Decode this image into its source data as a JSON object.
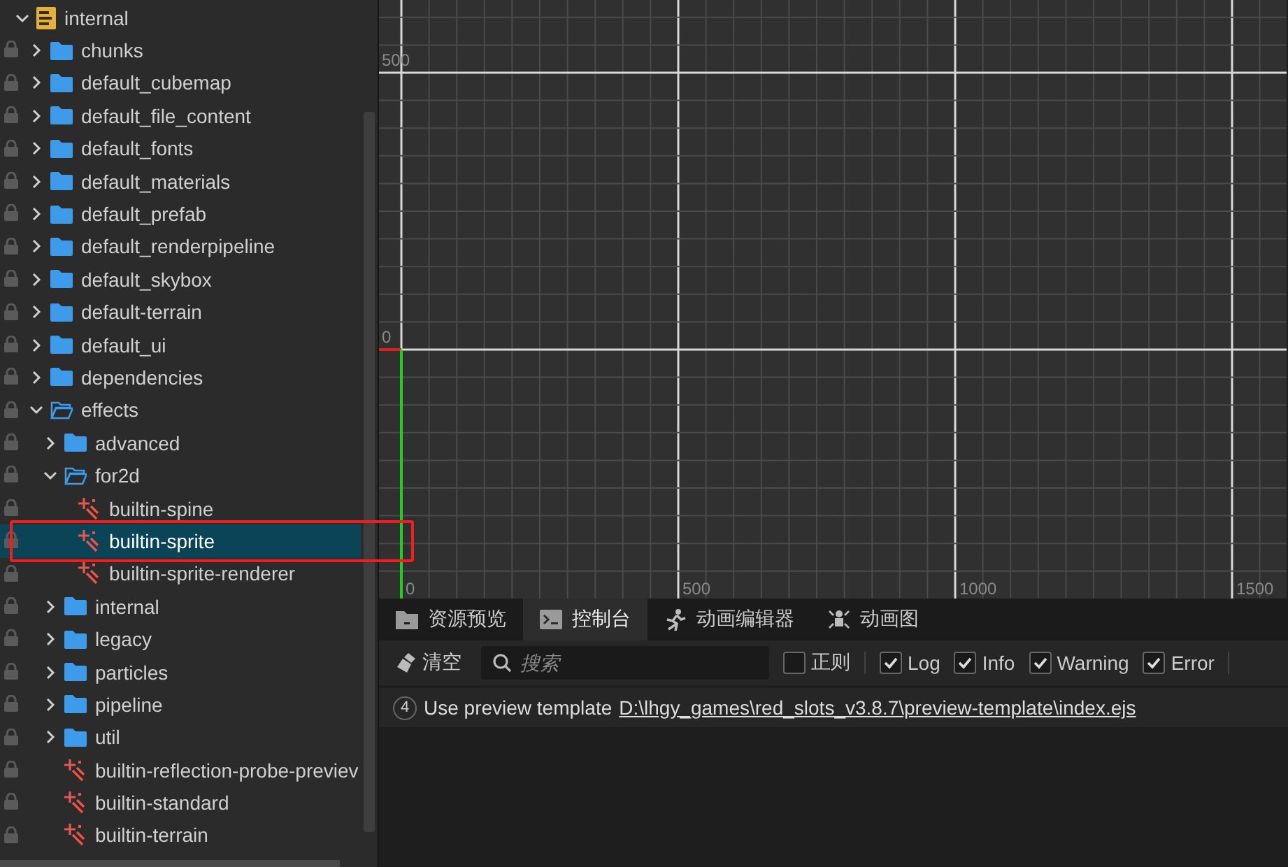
{
  "tree": [
    {
      "label": "internal",
      "kind": "bundle",
      "locked": false,
      "expanded": true,
      "selected": false,
      "children": [
        {
          "label": "chunks",
          "kind": "folder",
          "locked": true,
          "expanded": false,
          "selected": false
        },
        {
          "label": "default_cubemap",
          "kind": "folder",
          "locked": true,
          "expanded": false,
          "selected": false
        },
        {
          "label": "default_file_content",
          "kind": "folder",
          "locked": true,
          "expanded": false,
          "selected": false
        },
        {
          "label": "default_fonts",
          "kind": "folder",
          "locked": true,
          "expanded": false,
          "selected": false
        },
        {
          "label": "default_materials",
          "kind": "folder",
          "locked": true,
          "expanded": false,
          "selected": false
        },
        {
          "label": "default_prefab",
          "kind": "folder",
          "locked": true,
          "expanded": false,
          "selected": false
        },
        {
          "label": "default_renderpipeline",
          "kind": "folder",
          "locked": true,
          "expanded": false,
          "selected": false
        },
        {
          "label": "default_skybox",
          "kind": "folder",
          "locked": true,
          "expanded": false,
          "selected": false
        },
        {
          "label": "default-terrain",
          "kind": "folder",
          "locked": true,
          "expanded": false,
          "selected": false
        },
        {
          "label": "default_ui",
          "kind": "folder",
          "locked": true,
          "expanded": false,
          "selected": false
        },
        {
          "label": "dependencies",
          "kind": "folder",
          "locked": true,
          "expanded": false,
          "selected": false
        },
        {
          "label": "effects",
          "kind": "folder",
          "locked": true,
          "expanded": true,
          "selected": false,
          "children": [
            {
              "label": "advanced",
              "kind": "folder",
              "locked": true,
              "expanded": false,
              "selected": false
            },
            {
              "label": "for2d",
              "kind": "folder",
              "locked": true,
              "expanded": true,
              "selected": false,
              "children": [
                {
                  "label": "builtin-spine",
                  "kind": "effect",
                  "locked": true,
                  "selected": false
                },
                {
                  "label": "builtin-sprite",
                  "kind": "effect",
                  "locked": true,
                  "selected": true
                },
                {
                  "label": "builtin-sprite-renderer",
                  "kind": "effect",
                  "locked": true,
                  "selected": false
                }
              ]
            },
            {
              "label": "internal",
              "kind": "folder",
              "locked": true,
              "expanded": false,
              "selected": false
            },
            {
              "label": "legacy",
              "kind": "folder",
              "locked": true,
              "expanded": false,
              "selected": false
            },
            {
              "label": "particles",
              "kind": "folder",
              "locked": true,
              "expanded": false,
              "selected": false
            },
            {
              "label": "pipeline",
              "kind": "folder",
              "locked": true,
              "expanded": false,
              "selected": false
            },
            {
              "label": "util",
              "kind": "folder",
              "locked": true,
              "expanded": false,
              "selected": false
            },
            {
              "label": "builtin-reflection-probe-previev",
              "kind": "effect",
              "locked": true,
              "selected": false
            },
            {
              "label": "builtin-standard",
              "kind": "effect",
              "locked": true,
              "selected": false
            },
            {
              "label": "builtin-terrain",
              "kind": "effect",
              "locked": true,
              "selected": false
            }
          ]
        }
      ]
    }
  ],
  "scene": {
    "y_labels": [
      "500",
      "0"
    ],
    "x_labels": [
      "0",
      "500",
      "1000",
      "1500"
    ]
  },
  "tabs": [
    {
      "label": "资源预览",
      "kind": "assets",
      "selected": false
    },
    {
      "label": "控制台",
      "kind": "console",
      "selected": true
    },
    {
      "label": "动画编辑器",
      "kind": "animation",
      "selected": false
    },
    {
      "label": "动画图",
      "kind": "graph",
      "selected": false
    }
  ],
  "toolbar": {
    "clear": "清空",
    "search_placeholder": "搜索",
    "filters": [
      {
        "label": "正则",
        "checked": false
      },
      {
        "label": "Log",
        "checked": true
      },
      {
        "label": "Info",
        "checked": true
      },
      {
        "label": "Warning",
        "checked": true
      },
      {
        "label": "Error",
        "checked": true
      }
    ]
  },
  "log": [
    {
      "count": "4",
      "text": "Use preview template",
      "link": "D:\\lhgy_games\\red_slots_v3.8.7\\preview-template\\index.ejs"
    }
  ]
}
